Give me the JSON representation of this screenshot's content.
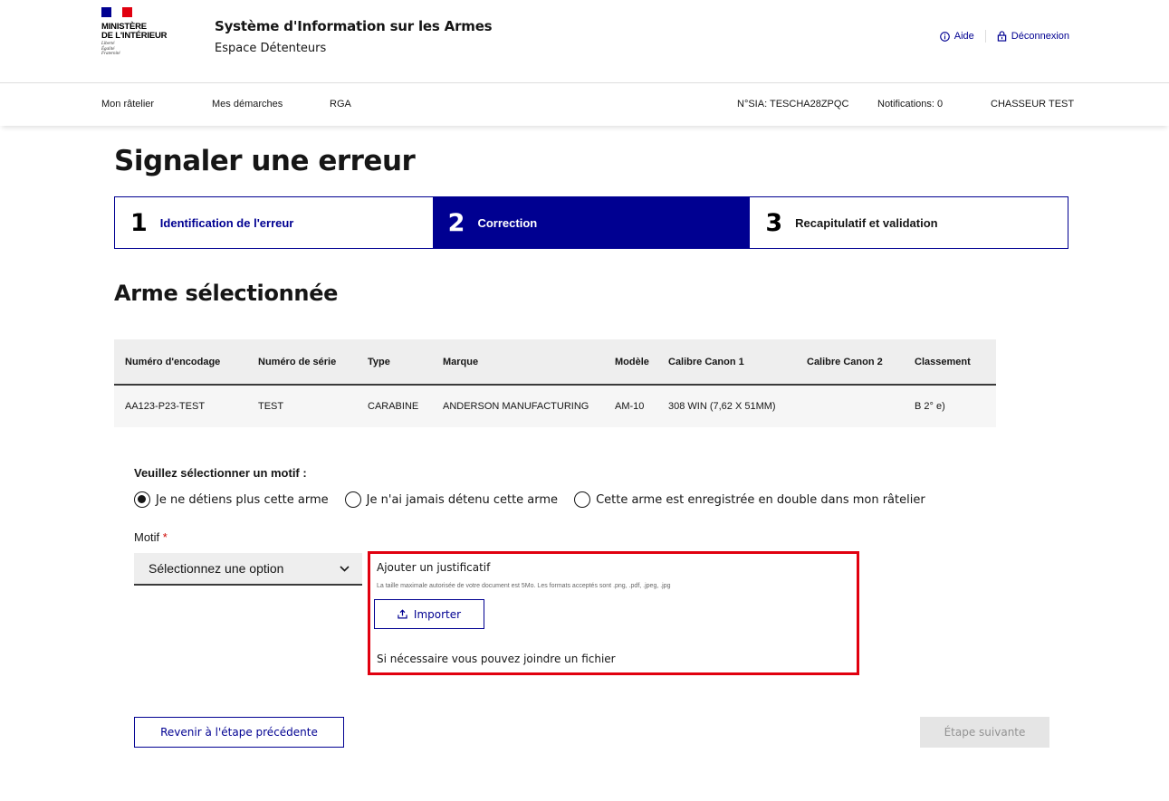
{
  "header": {
    "logo_lines": "MINISTÈRE\nDE L'INTÉRIEUR",
    "logo_motto": "Liberté\nÉgalité\nFraternité",
    "app_title": "Système d'Information sur les Armes",
    "app_subtitle": "Espace Détenteurs",
    "help_label": "Aide",
    "logout_label": "Déconnexion"
  },
  "nav": {
    "items": [
      "Mon râtelier",
      "Mes démarches",
      "RGA"
    ],
    "sia_number": "N°SIA: TESCHA28ZPQC",
    "notifications": "Notifications: 0",
    "user": "CHASSEUR TEST"
  },
  "page": {
    "title": "Signaler une erreur"
  },
  "stepper": {
    "steps": [
      {
        "num": "1",
        "label": "Identification de l'erreur"
      },
      {
        "num": "2",
        "label": "Correction"
      },
      {
        "num": "3",
        "label": "Recapitulatif et validation"
      }
    ],
    "active_index": 1
  },
  "weapon": {
    "section_title": "Arme sélectionnée",
    "columns": [
      "Numéro d'encodage",
      "Numéro de série",
      "Type",
      "Marque",
      "Modèle",
      "Calibre Canon 1",
      "Calibre Canon 2",
      "Classement"
    ],
    "row": [
      "AA123-P23-TEST",
      "TEST",
      "CARABINE",
      "ANDERSON MANUFACTURING",
      "AM-10",
      "308 WIN (7,62 X 51MM)",
      "",
      "B 2° e)"
    ]
  },
  "motif": {
    "prompt": "Veuillez sélectionner un motif :",
    "options": [
      "Je ne détiens plus cette arme",
      "Je n'ai jamais détenu cette arme",
      "Cette arme est enregistrée en double dans mon râtelier"
    ],
    "selected_index": 0,
    "field_label": "Motif",
    "required_mark": "*",
    "select_value": "Sélectionnez une option"
  },
  "upload": {
    "title": "Ajouter un justificatif",
    "hint": "La taille maximale autorisée de votre document est 5Mo. Les formats acceptés sont .png, .pdf, .jpeg, .jpg",
    "button_label": "Importer",
    "note": "Si nécessaire vous pouvez joindre un fichier"
  },
  "actions": {
    "prev_label": "Revenir à l'étape précédente",
    "next_label": "Étape suivante"
  },
  "colors": {
    "primary": "#000091",
    "highlight": "#e1000f",
    "required": "#ce0500",
    "disabled_bg": "#e5e5e5"
  }
}
